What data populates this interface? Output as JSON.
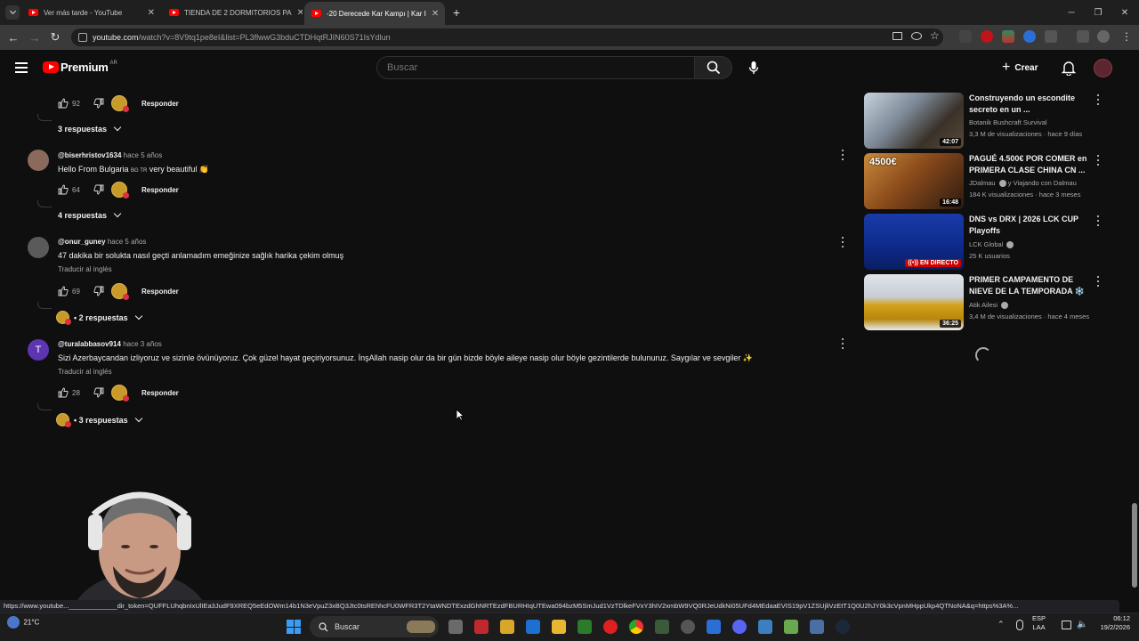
{
  "browser": {
    "tabs": [
      {
        "label": "Ver más tarde - YouTube",
        "active": false
      },
      {
        "label": "TIENDA DE 2 DORMITORIOS PA",
        "active": false
      },
      {
        "label": "-20 Derecede Kar Kampı | Kar I",
        "active": true
      }
    ],
    "new_tab": "+",
    "url_host": "youtube.com",
    "url_path": "/watch?v=8V9tq1pe8eI&list=PL3flwwG3bduCTDHqtRJIN60S71IsYdlun",
    "status_url": "https://www.youtube..._____________dir_token=QUFFLUhqbnIxUlIEa3JudF9XREQ5eEdOWm14b1N3eVpuZ3xBQ3Jtc0tsREhhcFU0WFR3T2YtaWNDTExzdGhNRTEzdFBURHIqUTEwa094bzM5SmJud1VzTDlkeFVxY3hIV2xmbW9VQ0RJeUdkNi05UFd4MEdaaEVIS19pV1ZSUjliVzEtT1Q0U2hJY0k3cVpnMHppUkp4QTNoNA&q=https%3A%..."
  },
  "youtube": {
    "logo_text": "Premium",
    "country": "AR",
    "search_placeholder": "Buscar",
    "create_label": "Crear"
  },
  "comments": [
    {
      "partial": true,
      "likes": "92",
      "reply_label": "Responder",
      "replies_label": "3 respuestas"
    },
    {
      "user": "@biserhristov1634",
      "time": "hace 5 años",
      "text_before": "Hello From Bulgaria",
      "flags": "BG TR",
      "text_after": "very beautiful 👏",
      "likes": "64",
      "reply_label": "Responder",
      "replies_label": "4 respuestas"
    },
    {
      "user": "@onur_guney",
      "time": "hace 5 años",
      "text": "47 dakika bir solukta nasıl geçti anlamadım emeğinize sağlık harika çekim olmuş",
      "translate": "Traducir al inglés",
      "likes": "69",
      "reply_label": "Responder",
      "replies_label": "• 2 respuestas"
    },
    {
      "user": "@turalabbasov914",
      "time": "hace 3 años",
      "avatar_letter": "T",
      "text": "Sizi Azerbaycandan izliyoruz ve sizinle övünüyoruz. Çok güzel hayat geçiriyorsunuz. İnşAllah nasip olur da bir gün bizde böyle aileye nasip olur böyle gezintilerde bulunuruz. Saygılar ve sevgiler ✨",
      "translate": "Traducir al inglés",
      "likes": "28",
      "reply_label": "Responder",
      "replies_label": "• 3 respuestas"
    }
  ],
  "sidebar": [
    {
      "title": "Construyendo un escondite secreto en un ...",
      "channel": "Botanik Bushcraft Survival",
      "meta": "3,3 M de visualizaciones · hace 9 días",
      "badge": "42:07",
      "live": false
    },
    {
      "title": "PAGUÉ 4.500€ POR COMER en PRIMERA CLASE CHINA CN ...",
      "channel": "JDalmau",
      "channel_suffix": "y Viajando con Dalmau",
      "meta": "184 K visualizaciones · hace 3 meses",
      "badge": "16:48",
      "thumb_text": "4500€",
      "live": false
    },
    {
      "title": "DNS vs DRX | 2026 LCK CUP Playoffs",
      "channel": "LCK Global",
      "meta": "25 K usuarios",
      "badge": "EN DIRECTO",
      "live": true
    },
    {
      "title": "PRIMER CAMPAMENTO DE NIEVE DE LA TEMPORADA ❄️",
      "channel": "Atik Ailesi",
      "meta": "3,4 M de visualizaciones · hace 4 meses",
      "badge": "36:25",
      "live": false
    }
  ],
  "taskbar": {
    "weather_temp": "21°C",
    "search_label": "Buscar",
    "lang_top": "ESP",
    "lang_bottom": "LAA",
    "time": "06:12",
    "date": "19/2/2026"
  },
  "colors": {
    "background": "#0f0f0f",
    "youtube_red": "#ff0000",
    "live_red": "#cc0000",
    "text_primary": "#f1f1f1",
    "text_secondary": "#aaaaaa"
  }
}
